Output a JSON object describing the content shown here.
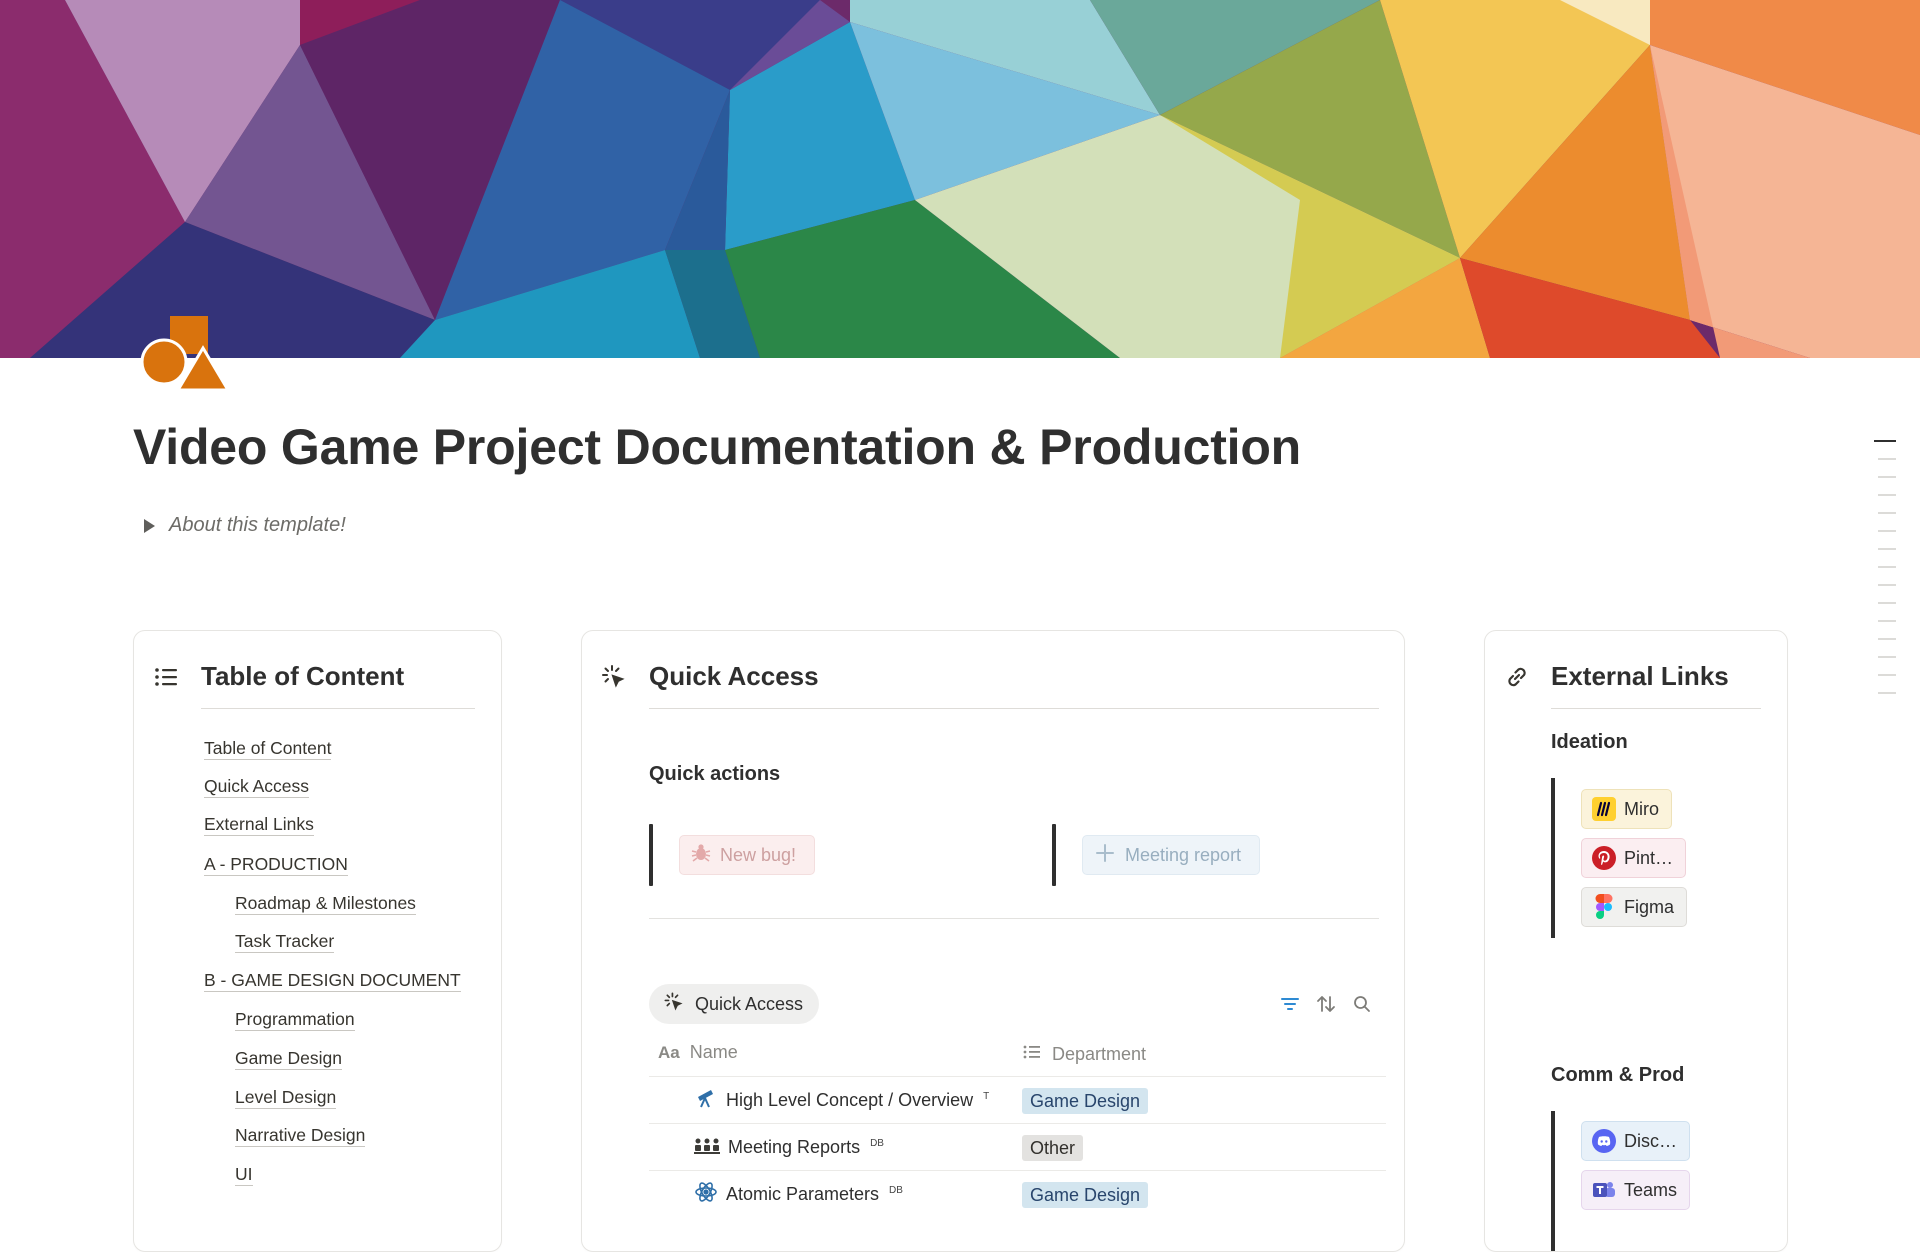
{
  "page": {
    "title": "Video Game Project Documentation & Production",
    "toggle_label": "About this template!"
  },
  "icons": {
    "page": "shapes-icon",
    "toc": "list-icon",
    "quick_access": "sparkle-cursor-icon",
    "external_links": "link-icon"
  },
  "colors": {
    "page_icon": "#d9730d",
    "tag_blue": "#d3e5ef",
    "tag_grey": "#e3e2e0"
  },
  "toc": {
    "title": "Table of Content",
    "items": [
      {
        "label": "Table of Content",
        "level": 0
      },
      {
        "label": "Quick Access",
        "level": 0
      },
      {
        "label": "External Links",
        "level": 0
      },
      {
        "label": "A - PRODUCTION",
        "level": 0
      },
      {
        "label": "Roadmap & Milestones",
        "level": 1
      },
      {
        "label": "Task Tracker",
        "level": 1
      },
      {
        "label": "B - GAME DESIGN DOCUMENT",
        "level": 0
      },
      {
        "label": "Programmation",
        "level": 1
      },
      {
        "label": "Game Design",
        "level": 1
      },
      {
        "label": "Level Design",
        "level": 1
      },
      {
        "label": "Narrative Design",
        "level": 1
      },
      {
        "label": "UI",
        "level": 1
      }
    ]
  },
  "quick_access": {
    "title": "Quick Access",
    "actions_heading": "Quick actions",
    "actions": [
      {
        "label": "New bug!",
        "icon": "bug-icon"
      },
      {
        "label": "Meeting report",
        "icon": "plus-icon"
      }
    ],
    "view_label": "Quick Access",
    "columns": [
      {
        "label": "Name",
        "icon": "text-aa-icon"
      },
      {
        "label": "Department",
        "icon": "list-icon"
      }
    ],
    "rows": [
      {
        "name": "High Level Concept / Overview",
        "badge": "T",
        "icon": "telescope-icon",
        "department": "Game Design",
        "tag_color": "blue"
      },
      {
        "name": "Meeting Reports",
        "badge": "DB",
        "icon": "people-icon",
        "department": "Other",
        "tag_color": "grey"
      },
      {
        "name": "Atomic Parameters",
        "badge": "DB",
        "icon": "atom-icon",
        "department": "Game Design",
        "tag_color": "blue"
      }
    ]
  },
  "external_links": {
    "title": "External Links",
    "groups": [
      {
        "heading": "Ideation",
        "links": [
          {
            "label": "Miro",
            "icon": "miro-icon"
          },
          {
            "label": "Pint…",
            "icon": "pinterest-icon"
          },
          {
            "label": "Figma",
            "icon": "figma-icon"
          }
        ]
      },
      {
        "heading": "Comm & Prod",
        "links": [
          {
            "label": "Disc…",
            "icon": "discord-icon"
          },
          {
            "label": "Teams",
            "icon": "teams-icon"
          }
        ]
      }
    ]
  }
}
